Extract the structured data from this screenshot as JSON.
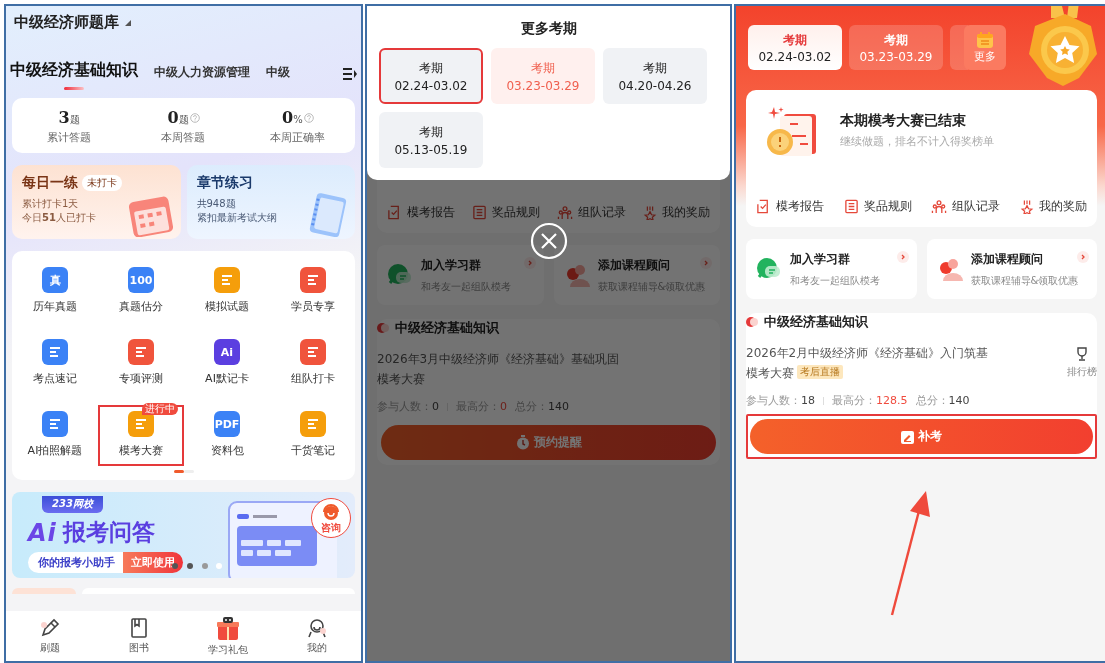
{
  "home": {
    "title": "中级经济师题库",
    "subject_tabs": [
      {
        "label": "中级经济基础知识",
        "selected": true
      },
      {
        "label": "中级人力资源管理",
        "selected": false
      },
      {
        "label": "中级",
        "selected": false
      }
    ],
    "stats": [
      {
        "value": "3",
        "unit": "题",
        "label": "累计答题",
        "help": false
      },
      {
        "value": "0",
        "unit": "题",
        "label": "本周答题",
        "help": true
      },
      {
        "value": "0",
        "unit": "%",
        "label": "本周正确率",
        "help": true
      }
    ],
    "practice_cards": [
      {
        "kind": "daily",
        "title": "每日一练",
        "badge": "未打卡",
        "lines": [
          "累计打卡1天",
          "今日**51**人已打卡"
        ]
      },
      {
        "kind": "chapter",
        "title": "章节练习",
        "lines": [
          "共948题",
          "紧扣最新考试大纲"
        ]
      }
    ],
    "features": [
      {
        "label": "历年真题",
        "icon_text": "真",
        "color": "#3b82f6",
        "highlighted": false
      },
      {
        "label": "真题估分",
        "icon_text": "100",
        "color": "#3b82f6",
        "highlighted": false
      },
      {
        "label": "模拟试题",
        "color": "#f59e0b",
        "highlighted": false
      },
      {
        "label": "学员专享",
        "color": "#f0543c",
        "highlighted": false
      },
      {
        "label": "考点速记",
        "color": "#3b82f6",
        "highlighted": false
      },
      {
        "label": "专项评测",
        "color": "#f0543c",
        "highlighted": false
      },
      {
        "label": "AI默记卡",
        "icon_text": "Ai",
        "color": "#5b3fe0",
        "highlighted": false
      },
      {
        "label": "组队打卡",
        "color": "#f0543c",
        "highlighted": false
      },
      {
        "label": "AI拍照解题",
        "color": "#3b82f6",
        "highlighted": false
      },
      {
        "label": "模考大赛",
        "color": "#f59e0b",
        "badge": "进行中",
        "highlighted": true
      },
      {
        "label": "资料包",
        "icon_text": "PDF",
        "color": "#3b82f6",
        "highlighted": false
      },
      {
        "label": "干货笔记",
        "color": "#f59e0b",
        "highlighted": false
      }
    ],
    "banner": {
      "brand": "233网校",
      "logo": "Ai",
      "headline": "报考问答",
      "tagline": "你的报考小助手",
      "action": "立即使用",
      "consult": "咨询"
    },
    "bottom_nav": [
      {
        "label": "刷题"
      },
      {
        "label": "图书"
      },
      {
        "label": "学习礼包"
      },
      {
        "label": "我的"
      }
    ]
  },
  "period_sheet": {
    "title": "更多考期",
    "periods": [
      {
        "label": "考期",
        "dates": "02.24-03.02",
        "selected": false,
        "highlighted": true
      },
      {
        "label": "考期",
        "dates": "03.23-03.29",
        "selected": true,
        "highlighted": false
      },
      {
        "label": "考期",
        "dates": "04.20-04.26",
        "selected": false,
        "highlighted": false
      },
      {
        "label": "考期",
        "dates": "05.13-05.19",
        "selected": false,
        "highlighted": false
      }
    ]
  },
  "sheet_background": {
    "actions": [
      {
        "label": "模考报告"
      },
      {
        "label": "奖品规则"
      },
      {
        "label": "组队记录"
      },
      {
        "label": "我的奖励"
      }
    ],
    "services": [
      {
        "title": "加入学习群",
        "subtitle": "和考友一起组队模考"
      },
      {
        "title": "添加课程顾问",
        "subtitle": "获取课程辅导&领取优惠"
      }
    ],
    "card": {
      "subject": "中级经济基础知识",
      "title": "2026年3月中级经济师《经济基础》基础巩固模考大赛",
      "stats": [
        {
          "label": "参与人数：",
          "value": "0",
          "emphasis": false
        },
        {
          "label": "最高分：",
          "value": "0",
          "emphasis": true
        },
        {
          "label": "总分：",
          "value": "140",
          "emphasis": false
        }
      ],
      "button": "预约提醒"
    }
  },
  "contest": {
    "period_tabs": [
      {
        "label": "考期",
        "dates": "02.24-03.02",
        "selected": true
      },
      {
        "label": "考期",
        "dates": "03.23-03.29",
        "selected": false
      }
    ],
    "more": "更多",
    "status": {
      "title": "本期模考大赛已结束",
      "subtitle": "继续做题，排名不计入得奖榜单"
    },
    "actions": [
      {
        "label": "模考报告"
      },
      {
        "label": "奖品规则"
      },
      {
        "label": "组队记录"
      },
      {
        "label": "我的奖励"
      }
    ],
    "services": [
      {
        "title": "加入学习群",
        "subtitle": "和考友一起组队模考"
      },
      {
        "title": "添加课程顾问",
        "subtitle": "获取课程辅导&领取优惠"
      }
    ],
    "card": {
      "subject": "中级经济基础知识",
      "title": "2026年2月中级经济师《经济基础》入门筑基模考大赛",
      "tag": "考后直播",
      "ranking": "排行榜",
      "stats": [
        {
          "label": "参与人数：",
          "value": "18",
          "emphasis": false
        },
        {
          "label": "最高分：",
          "value": "128.5",
          "emphasis": true
        },
        {
          "label": "总分：",
          "value": "140",
          "emphasis": false
        }
      ],
      "button": "补考",
      "highlighted": true
    }
  }
}
